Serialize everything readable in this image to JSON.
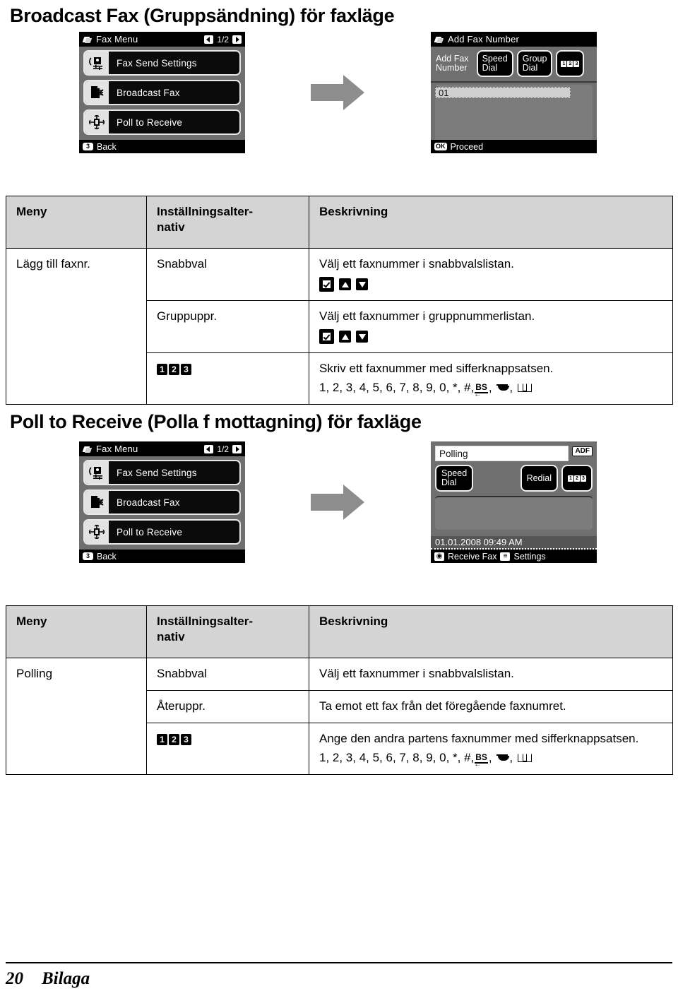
{
  "page": {
    "number": "20",
    "chapter": "Bilaga"
  },
  "sections": [
    {
      "heading": "Broadcast Fax (Gruppsändning) för faxläge",
      "figure": {
        "arrow_icon": "right-arrow-icon",
        "left_screen": {
          "type": "fax-menu",
          "title": "Fax Menu",
          "title_icon": "fax-menu-icon",
          "prev_icon": "left-triangle-icon",
          "page_indicator": "1/2",
          "next_icon": "right-triangle-icon",
          "items": [
            {
              "label": "Fax Send Settings",
              "icon": "fax-send-settings-icon"
            },
            {
              "label": "Broadcast Fax",
              "icon": "broadcast-fax-icon"
            },
            {
              "label": "Poll to Receive",
              "icon": "poll-to-receive-icon"
            }
          ],
          "footer_key": "3",
          "footer_label": "Back"
        },
        "right_screen": {
          "type": "add-fax-number",
          "title": "Add Fax Number",
          "title_icon": "fax-menu-icon",
          "tiles": [
            {
              "label": "Add Fax\nNumber",
              "style": "plain"
            },
            {
              "label": "Speed\nDial",
              "style": "button"
            },
            {
              "label": "Group\nDial",
              "style": "button"
            },
            {
              "label": "123",
              "style": "keypad"
            }
          ],
          "entry_value": "01",
          "footer_key": "OK",
          "footer_label": "Proceed"
        }
      },
      "table": {
        "headers": [
          "Meny",
          "Inställningsalter-\nnativ",
          "Beskrivning"
        ],
        "menu_label": "Lägg till faxnr.",
        "rows": [
          {
            "option": "Snabbval",
            "option_kind": "text",
            "description": "Välj ett faxnummer i snabbvalslistan.",
            "keys": [
              "check-key",
              "up-arrow-key",
              "down-arrow-key"
            ],
            "digits": null
          },
          {
            "option": "Gruppuppr.",
            "option_kind": "text",
            "description": "Välj ett faxnummer i gruppnummerlistan.",
            "keys": [
              "check-key",
              "up-arrow-key",
              "down-arrow-key"
            ],
            "digits": null
          },
          {
            "option": "123",
            "option_kind": "keypad",
            "description": "Skriv ett faxnummer med sifferknappsatsen.",
            "keys": [],
            "digits": "1, 2, 3, 4, 5, 6, 7, 8, 9, 0, *, #,"
          }
        ]
      }
    },
    {
      "heading": "Poll to Receive (Polla f mottagning) för faxläge",
      "figure": {
        "arrow_icon": "right-arrow-icon",
        "left_screen": {
          "type": "fax-menu",
          "title": "Fax Menu",
          "title_icon": "fax-menu-icon",
          "prev_icon": "left-triangle-icon",
          "page_indicator": "1/2",
          "next_icon": "right-triangle-icon",
          "items": [
            {
              "label": "Fax Send Settings",
              "icon": "fax-send-settings-icon"
            },
            {
              "label": "Broadcast Fax",
              "icon": "broadcast-fax-icon"
            },
            {
              "label": "Poll to Receive",
              "icon": "poll-to-receive-icon"
            }
          ],
          "footer_key": "3",
          "footer_label": "Back"
        },
        "right_screen": {
          "type": "polling-standby",
          "field_value": "Polling",
          "adf_badge": "ADF",
          "speed_dial_label": "Speed\nDial",
          "redial_label": "Redial",
          "keypad_label": "123",
          "datetime": "01.01.2008  09:49 AM",
          "footer_items": [
            {
              "key": "start-icon",
              "label": "Receive Fax"
            },
            {
              "key": "menu-icon",
              "label": "Settings"
            }
          ]
        }
      },
      "table": {
        "headers": [
          "Meny",
          "Inställningsalter-\nnativ",
          "Beskrivning"
        ],
        "menu_label": "Polling",
        "rows": [
          {
            "option": "Snabbval",
            "option_kind": "text",
            "description": "Välj ett faxnummer i snabbvalslistan.",
            "keys": [],
            "digits": null
          },
          {
            "option": "Återuppr.",
            "option_kind": "text",
            "description": "Ta emot ett fax från det föregående faxnumret.",
            "keys": [],
            "digits": null
          },
          {
            "option": "123",
            "option_kind": "keypad",
            "description": "Ange den andra partens faxnummer med sifferknappsatsen.",
            "keys": [],
            "digits": "1, 2, 3, 4, 5, 6, 7, 8, 9, 0, *, #,"
          }
        ]
      }
    }
  ]
}
